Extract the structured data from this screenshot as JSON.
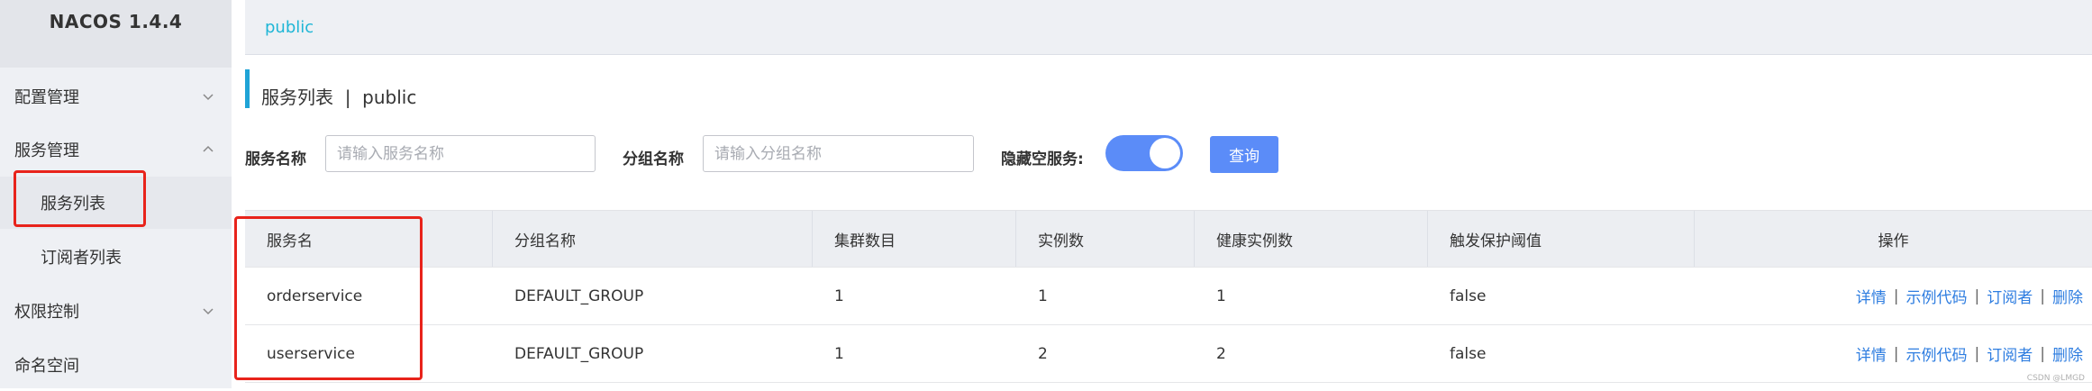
{
  "app": {
    "brand": "NACOS 1.4.4"
  },
  "sidebar": {
    "items": [
      {
        "label": "配置管理",
        "expanded": false
      },
      {
        "label": "服务管理",
        "expanded": true
      },
      {
        "label": "服务列表",
        "sub": true,
        "active": true
      },
      {
        "label": "订阅者列表",
        "sub": true
      },
      {
        "label": "权限控制",
        "expanded": false
      },
      {
        "label": "命名空间"
      }
    ]
  },
  "topbar": {
    "namespace": "public"
  },
  "page": {
    "title": "服务列表  |  public"
  },
  "filters": {
    "service_label": "服务名称",
    "service_placeholder": "请输入服务名称",
    "group_label": "分组名称",
    "group_placeholder": "请输入分组名称",
    "hide_empty_label": "隐藏空服务:",
    "hide_empty_on": true,
    "query_label": "查询"
  },
  "table": {
    "columns": [
      "服务名",
      "分组名称",
      "集群数目",
      "实例数",
      "健康实例数",
      "触发保护阈值",
      "操作"
    ],
    "rows": [
      [
        "orderservice",
        "DEFAULT_GROUP",
        "1",
        "1",
        "1",
        "false"
      ],
      [
        "userservice",
        "DEFAULT_GROUP",
        "1",
        "2",
        "2",
        "false"
      ]
    ],
    "actions": [
      "详情",
      "示例代码",
      "订阅者",
      "删除"
    ],
    "separator": "|"
  },
  "watermark": "CSDN @LMGD",
  "colors": {
    "accent": "#5b8cf8",
    "link": "#2e7de0",
    "namespace": "#1fb6d6",
    "highlight": "#e8231b"
  }
}
